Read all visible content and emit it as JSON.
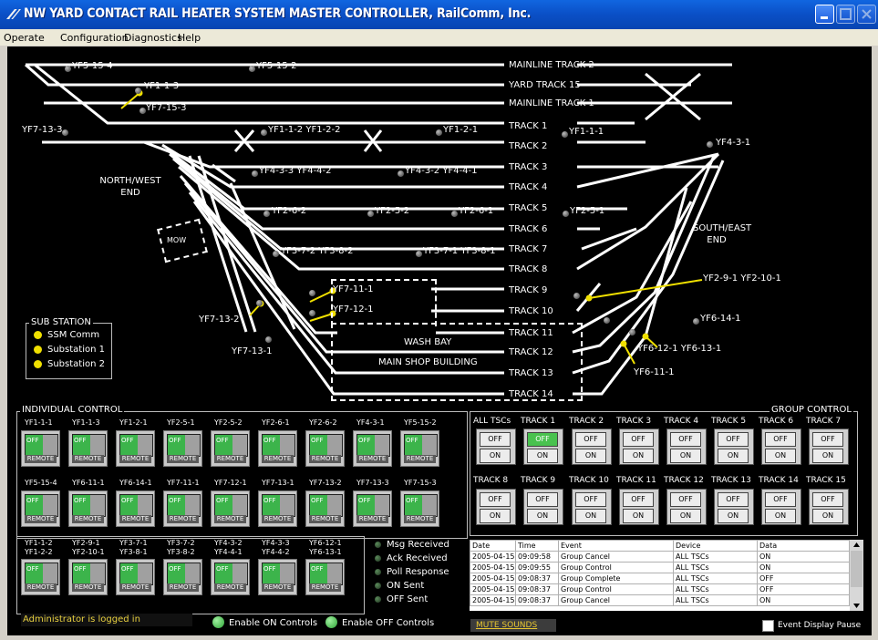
{
  "window": {
    "title": "NW YARD CONTACT RAIL HEATER SYSTEM MASTER CONTROLLER, RailComm, Inc."
  },
  "menu": [
    "Operate",
    "Configuration",
    "Diagnostics",
    "Help"
  ],
  "yard": {
    "track_labels": [
      "MAINLINE TRACK 2",
      "YARD TRACK 15",
      "MAINLINE TRACK 1",
      "TRACK 1",
      "TRACK 2",
      "TRACK 3",
      "TRACK 4",
      "TRACK 5",
      "TRACK 6",
      "TRACK 7",
      "TRACK 8",
      "TRACK 9",
      "TRACK 10",
      "TRACK 11",
      "TRACK 12",
      "TRACK 13",
      "TRACK 14"
    ],
    "region_labels": {
      "northwest": "NORTH/WEST\nEND",
      "southeast": "SOUTH/EAST\nEND",
      "mow": "MOW",
      "wash_bay": "WASH BAY",
      "main_shop": "MAIN SHOP BUILDING"
    },
    "heater_labels": [
      "YF5-15-4",
      "YF5-15-2",
      "YF1-1-3",
      "YF7-15-3",
      "YF7-13-3",
      "YF1-1-2 YF1-2-2",
      "YF1-2-1",
      "YF1-1-1",
      "YF4-3-1",
      "YF4-3-3 YF4-4-2",
      "YF4-3-2 YF4-4-1",
      "YF2-6-2",
      "YF2-5-2",
      "YF2-6-1",
      "YF2-5-1",
      "YF3-7-2 YF3-8-2",
      "YF3-7-1 YF3-8-1",
      "YF7-11-1",
      "YF7-12-1",
      "YF7-13-2",
      "YF7-13-1",
      "YF2-9-1 YF2-10-1",
      "YF6-14-1",
      "YF6-12-1 YF6-13-1",
      "YF6-11-1"
    ]
  },
  "substation": {
    "title": "SUB STATION",
    "items": [
      "SSM Comm",
      "Substation 1",
      "Substation 2"
    ],
    "led_color": "#f0e000"
  },
  "individual_control": {
    "title": "INDIVIDUAL CONTROL",
    "off_label": "OFF",
    "remote_label": "REMOTE",
    "row1": [
      "YF1-1-1",
      "YF1-1-3",
      "YF1-2-1",
      "YF2-5-1",
      "YF2-5-2",
      "YF2-6-1",
      "YF2-6-2",
      "YF4-3-1",
      "YF5-15-2"
    ],
    "row2": [
      "YF5-15-4",
      "YF6-11-1",
      "YF6-14-1",
      "YF7-11-1",
      "YF7-12-1",
      "YF7-13-1",
      "YF7-13-2",
      "YF7-13-3",
      "YF7-15-3"
    ],
    "row3": [
      [
        "YF1-1-2",
        "YF1-2-2"
      ],
      [
        "YF2-9-1",
        "YF2-10-1"
      ],
      [
        "YF3-7-1",
        "YF3-8-1"
      ],
      [
        "YF3-7-2",
        "YF3-8-2"
      ],
      [
        "YF4-3-2",
        "YF4-4-1"
      ],
      [
        "YF4-3-3",
        "YF4-4-2"
      ],
      [
        "YF6-12-1",
        "YF6-13-1"
      ]
    ]
  },
  "legend": {
    "items": [
      "Msg Received",
      "Ack Received",
      "Poll Response",
      "ON Sent",
      "OFF Sent"
    ]
  },
  "group_control": {
    "title": "GROUP CONTROL",
    "off_label": "OFF",
    "on_label": "ON",
    "row1": [
      "ALL TSCs",
      "TRACK 1",
      "TRACK 2",
      "TRACK 3",
      "TRACK 4",
      "TRACK 5",
      "TRACK 6",
      "TRACK 7"
    ],
    "row2": [
      "TRACK 8",
      "TRACK 9",
      "TRACK 10",
      "TRACK 11",
      "TRACK 12",
      "TRACK 13",
      "TRACK 14",
      "TRACK 15"
    ],
    "lit_off_index": 1
  },
  "event_log": {
    "columns": [
      "Date",
      "Time",
      "Event",
      "Device",
      "Data"
    ],
    "rows": [
      [
        "2005-04-15",
        "09:09:58",
        "Group Cancel",
        "ALL TSCs",
        "ON"
      ],
      [
        "2005-04-15",
        "09:09:55",
        "Group Control",
        "ALL TSCs",
        "ON"
      ],
      [
        "2005-04-15",
        "09:08:37",
        "Group Complete",
        "ALL TSCs",
        "OFF"
      ],
      [
        "2005-04-15",
        "09:08:37",
        "Group Control",
        "ALL TSCs",
        "OFF"
      ],
      [
        "2005-04-15",
        "09:08:37",
        "Group Cancel",
        "ALL TSCs",
        "ON"
      ]
    ]
  },
  "status": {
    "login": "Administrator is logged in",
    "enable_on": "Enable ON Controls",
    "enable_off": "Enable OFF Controls",
    "mute": "MUTE SOUNDS",
    "pause": "Event Display Pause",
    "indicator_color": "#49c24f",
    "login_color": "#e8d040"
  }
}
